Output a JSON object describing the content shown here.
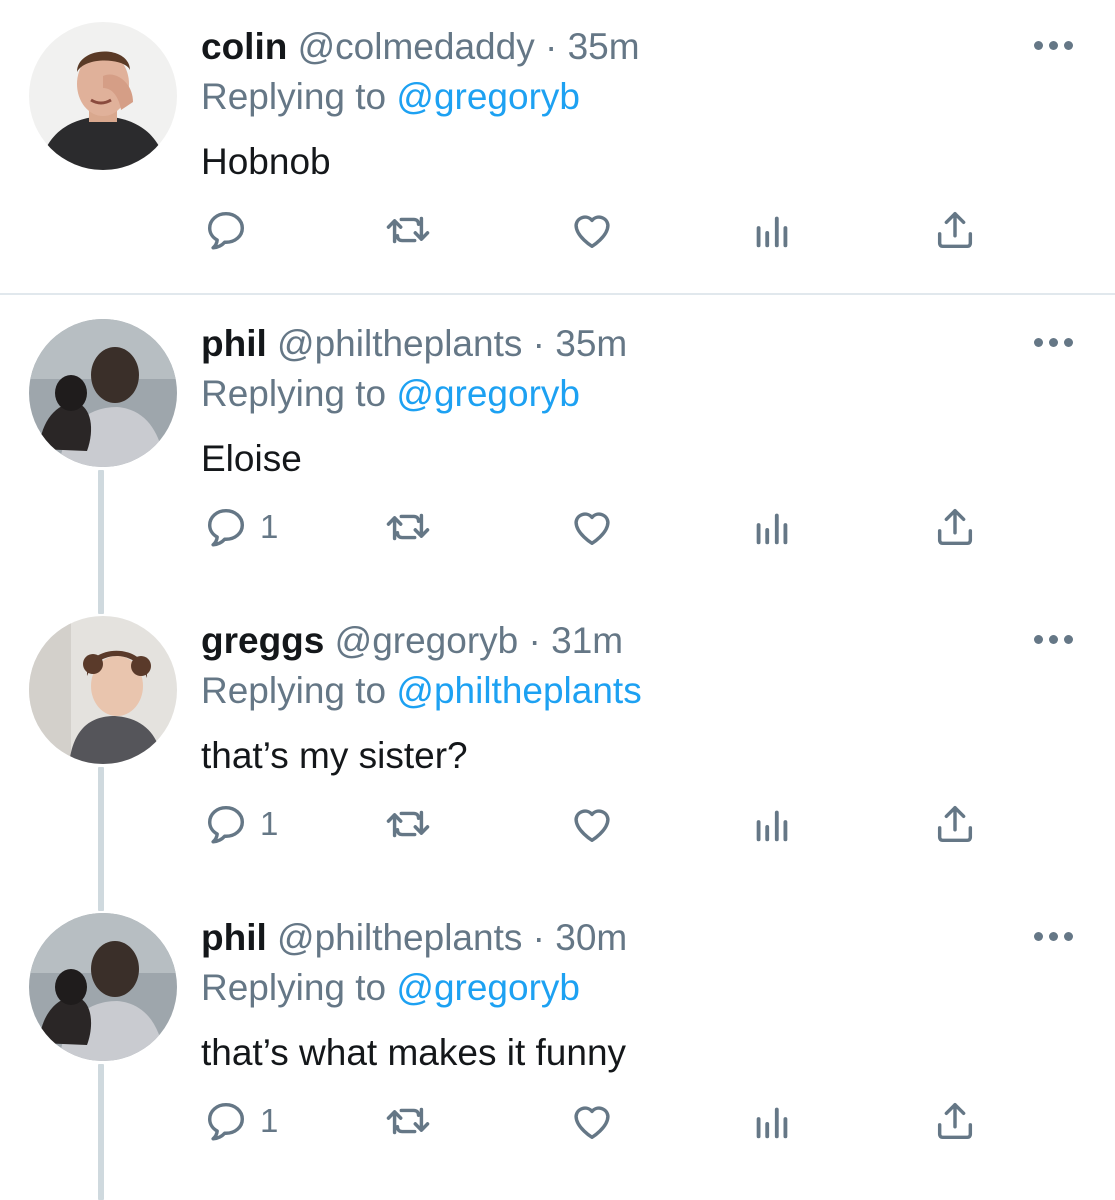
{
  "colors": {
    "text": "#14171a",
    "secondary": "#657786",
    "link": "#1da1f2",
    "divider": "#e1e8ed",
    "thread_line": "#cfd9de"
  },
  "tweets": [
    {
      "name": "colin",
      "handle": "@colmedaddy",
      "dot": "·",
      "time": "35m",
      "replying_prefix": "Replying to ",
      "replying_to": "@gregoryb",
      "text": "Hobnob",
      "reply_count": "",
      "avatar": "avatar-colin"
    },
    {
      "name": "phil",
      "handle": "@philtheplants",
      "dot": "·",
      "time": "35m",
      "replying_prefix": "Replying to ",
      "replying_to": "@gregoryb",
      "text": "Eloise",
      "reply_count": "1",
      "avatar": "avatar-phil"
    },
    {
      "name": "greggs",
      "handle": "@gregoryb",
      "dot": "·",
      "time": "31m",
      "replying_prefix": "Replying to ",
      "replying_to": "@philtheplants",
      "text": "that’s my sister?",
      "reply_count": "1",
      "avatar": "avatar-greggs"
    },
    {
      "name": "phil",
      "handle": "@philtheplants",
      "dot": "·",
      "time": "30m",
      "replying_prefix": "Replying to ",
      "replying_to": "@gregoryb",
      "text": "that’s what makes it funny",
      "reply_count": "1",
      "avatar": "avatar-phil"
    }
  ],
  "icons": [
    "reply-icon",
    "retweet-icon",
    "like-icon",
    "analytics-icon",
    "share-icon",
    "more-icon"
  ]
}
